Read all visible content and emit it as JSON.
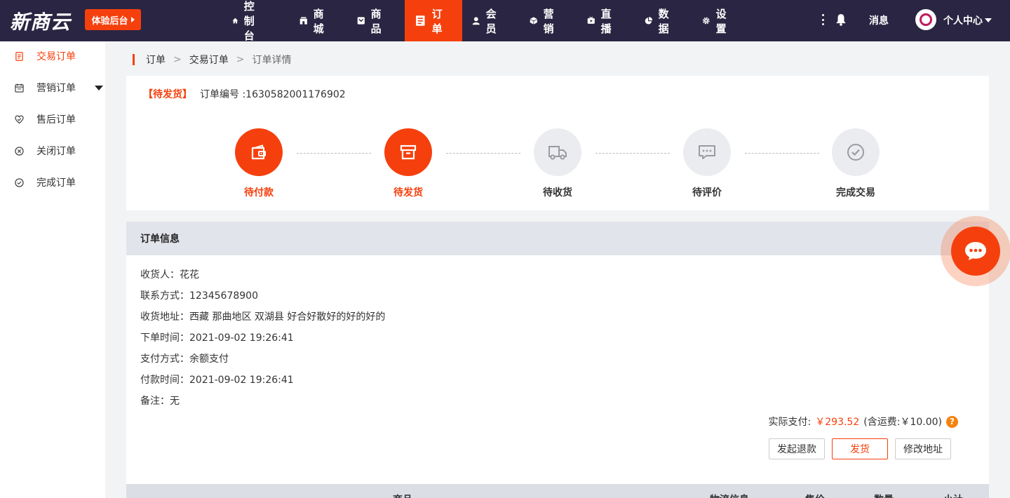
{
  "brand": "新商云",
  "trial_button": "体验后台",
  "nav": [
    {
      "label": "控制台",
      "icon": "home-icon"
    },
    {
      "label": "商城",
      "icon": "store-icon"
    },
    {
      "label": "商品",
      "icon": "goods-icon"
    },
    {
      "label": "订单",
      "icon": "order-icon",
      "active": true
    },
    {
      "label": "会员",
      "icon": "member-icon"
    },
    {
      "label": "营销",
      "icon": "marketing-icon"
    },
    {
      "label": "直播",
      "icon": "live-icon"
    },
    {
      "label": "数据",
      "icon": "data-icon"
    },
    {
      "label": "设置",
      "icon": "gear-icon"
    }
  ],
  "header_right": {
    "messages": "消息",
    "user_center": "个人中心"
  },
  "sidebar": [
    {
      "label": "交易订单",
      "icon": "receipt-icon",
      "active": true
    },
    {
      "label": "营销订单",
      "icon": "calendar-icon",
      "expandable": true
    },
    {
      "label": "售后订单",
      "icon": "heart-icon"
    },
    {
      "label": "关闭订单",
      "icon": "close-circle-icon"
    },
    {
      "label": "完成订单",
      "icon": "check-circle-icon"
    }
  ],
  "breadcrumb": {
    "level1": "订单",
    "level2": "交易订单",
    "current": "订单详情",
    "separator": ">"
  },
  "order": {
    "status_tag": "【待发货】",
    "number_label": "订单编号 :1630582001176902"
  },
  "steps": [
    {
      "label": "待付款",
      "done": true,
      "icon": "wallet-icon"
    },
    {
      "label": "待发货",
      "done": true,
      "icon": "box-icon"
    },
    {
      "label": "待收货",
      "done": false,
      "icon": "truck-icon"
    },
    {
      "label": "待评价",
      "done": false,
      "icon": "comment-icon"
    },
    {
      "label": "完成交易",
      "done": false,
      "icon": "check-icon"
    }
  ],
  "info": {
    "title": "订单信息",
    "rows": [
      "收货人：花花",
      "联系方式：12345678900",
      "收货地址：西藏 那曲地区 双湖县 好合好散好的好的好的",
      "下单时间：2021-09-02 19:26:41",
      "支付方式：余额支付",
      "付款时间：2021-09-02 19:26:41",
      "备注：无"
    ],
    "paid_label": "实际支付:",
    "paid_amount": "￥293.52",
    "shipping": "(含运费:￥10.00)",
    "help": "?"
  },
  "actions": {
    "refund": "发起退款",
    "ship": "发货",
    "edit_address": "修改地址"
  },
  "table_headers": {
    "product": "商品",
    "logistics": "物流信息",
    "price": "售价",
    "qty": "数量",
    "subtotal": "小计"
  },
  "colors": {
    "accent": "#f5400e",
    "topbar": "#2a2542"
  }
}
